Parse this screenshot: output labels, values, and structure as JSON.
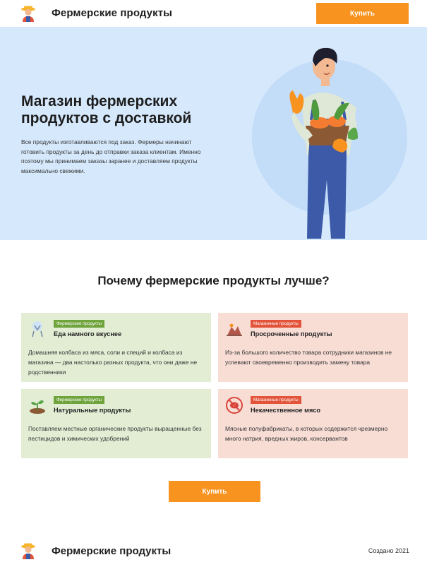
{
  "header": {
    "logo_icon": "farmer-icon",
    "brand": "Фермерские продукты",
    "buy_label": "Купить"
  },
  "hero": {
    "title": "Магазин фермерских продуктов с доставкой",
    "text": "Все продукты изготавливаются под заказ. Фермеры начинают готовить продукты за день до отправки заказа клиентам. Именно поэтому мы принимаем заказы заранее и доставляем продукты максимально свежими.",
    "illustration": "farmer-with-vegetable-basket",
    "bg_color": "#d6e9fc"
  },
  "why": {
    "title": "Почему фермерские продукты лучше?",
    "cards": [
      {
        "icon": "sausage-icon",
        "badge": "Фермерские продукты",
        "title": "Еда намного вкуснее",
        "text": "Домашняя колбаса из мяса, соли и специй и колбаса из магазина — два настолько разных продукта, что они даже не родственники"
      },
      {
        "icon": "spoiled-food-icon",
        "badge": "Магазинные продукты",
        "title": "Просроченные продукты",
        "text": "Из-за большого количество товара сотрудники магазинов не успевают своевременно производить замену товара"
      },
      {
        "icon": "sprout-icon",
        "badge": "Фермерские продукты",
        "title": "Натуральные продукты",
        "text": "Поставляем местные органические продукты выращенные без пестицидов и химических удобрений"
      },
      {
        "icon": "no-meat-icon",
        "badge": "Магазинные продукты",
        "title": "Некачественное мясо",
        "text": "Мясные полуфабрикаты, в которых содержится чрезмерно много натрия, вредных жиров, консервантов"
      }
    ]
  },
  "cta": {
    "buy_label": "Купить"
  },
  "footer": {
    "brand": "Фермерские продукты",
    "copyright": "Создано 2021"
  },
  "colors": {
    "accent": "#f7931e",
    "good_card": "#e2edd4",
    "bad_card": "#f8ddd5",
    "good_badge": "#6fa33c",
    "bad_badge": "#e2533a"
  }
}
